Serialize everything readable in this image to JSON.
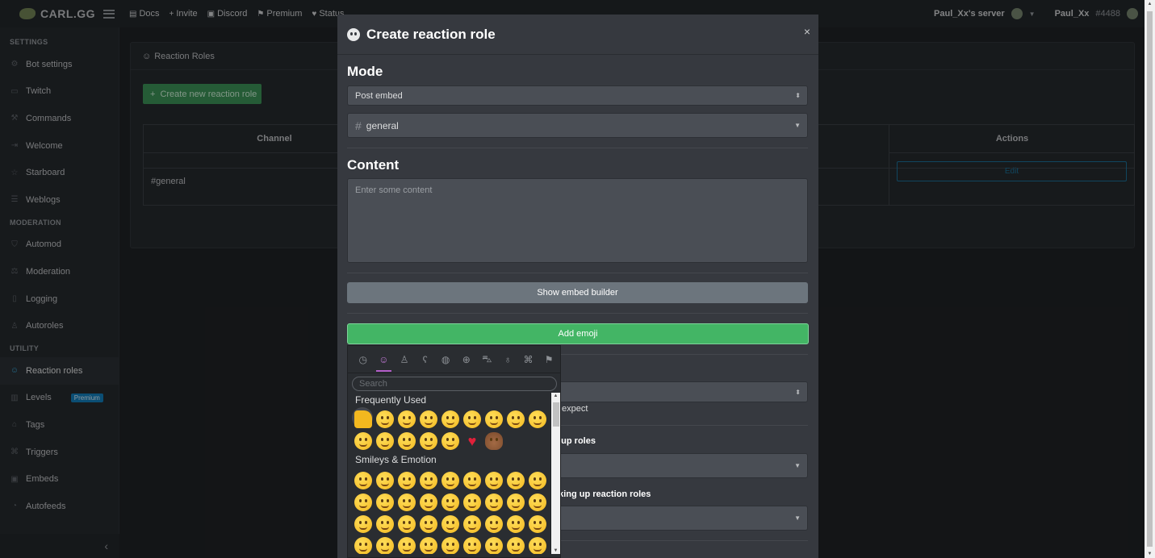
{
  "brand": {
    "name": "CARL.GG",
    "logo_icon": "turtle-logo-icon"
  },
  "topnav": [
    {
      "label": "Docs",
      "icon": "book-icon"
    },
    {
      "label": "Invite",
      "icon": "plus-icon"
    },
    {
      "label": "Discord",
      "icon": "discord-icon"
    },
    {
      "label": "Premium",
      "icon": "flag-icon"
    },
    {
      "label": "Status",
      "icon": "heartbeat-icon"
    }
  ],
  "topright": {
    "server": "Paul_Xx's server",
    "user": "Paul_Xx",
    "discriminator": "#4488"
  },
  "sidebar": {
    "sections": [
      {
        "title": "SETTINGS",
        "items": [
          "Bot settings",
          "Twitch",
          "Commands",
          "Welcome",
          "Starboard",
          "Weblogs"
        ]
      },
      {
        "title": "MODERATION",
        "items": [
          "Automod",
          "Moderation",
          "Logging",
          "Autoroles"
        ]
      },
      {
        "title": "UTILITY",
        "items": [
          "Reaction roles",
          "Levels",
          "Tags",
          "Triggers",
          "Embeds",
          "Autofeeds"
        ]
      }
    ],
    "premium_badge": "Premium",
    "collapse": "‹"
  },
  "page": {
    "card_title": "Reaction Roles",
    "create_button": "Create new reaction role",
    "table": {
      "col_channel": "Channel",
      "col_actions": "Actions",
      "row_channel": "#general",
      "edit": "Edit"
    }
  },
  "modal": {
    "title": "Create reaction role",
    "close": "×",
    "mode_heading": "Mode",
    "mode_value": "Post embed",
    "channel_value": "general",
    "content_heading": "Content",
    "content_placeholder": "Enter some content",
    "show_embed_builder": "Show embed builder",
    "add_emoji": "Add emoji",
    "partial_expect": "expect",
    "partial_pickup": "k up roles",
    "partial_picking": "cking up reaction roles"
  },
  "emoji_picker": {
    "search_placeholder": "Search",
    "cat_frequent": "Frequently Used",
    "cat_smileys": "Smileys & Emotion",
    "tabs": [
      "clock-icon",
      "smiley-icon",
      "person-icon",
      "bear-icon",
      "apple-icon",
      "ball-icon",
      "car-icon",
      "bulb-icon",
      "symbols-icon",
      "flag-icon"
    ]
  }
}
